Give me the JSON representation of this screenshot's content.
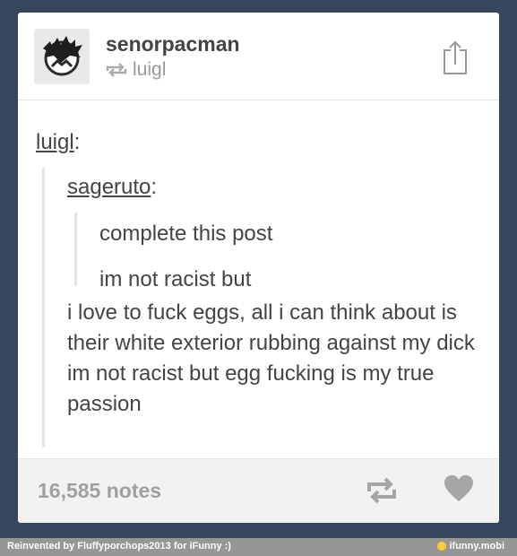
{
  "post": {
    "author": "senorpacman",
    "reblogged_from": "luigl",
    "thread": {
      "user1": "luigl",
      "user2": "sageruto",
      "original_lines": [
        "complete this post",
        "im not racist but"
      ],
      "reply": "i love to fuck eggs, all i can think about is their white exterior rubbing against my dick im not racist but egg fucking is my true passion"
    },
    "notes": "16,585 notes"
  },
  "watermark": {
    "credit": "Reinvented by Fluffyporchops2013 for iFunny :)",
    "brand": "ifunny.mobi"
  },
  "colors": {
    "background": "#36465d",
    "card": "#ffffff",
    "footer": "#f2f2f2",
    "brand_accent": "#ffcc33"
  },
  "icons": [
    "avatar",
    "reblog-icon",
    "share-icon",
    "heart-icon"
  ]
}
